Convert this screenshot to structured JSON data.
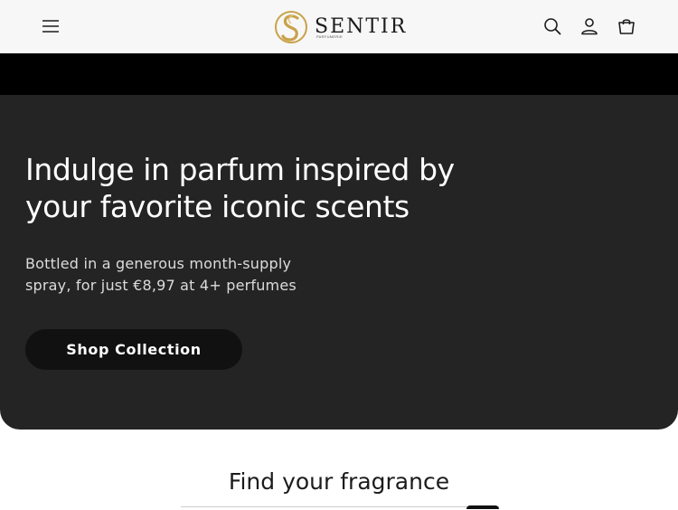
{
  "header": {
    "brand": "SENTIR",
    "brand_sub": "PARFUMERIE",
    "icons": {
      "menu": "hamburger-menu-icon",
      "search": "search-icon",
      "account": "account-icon",
      "cart": "cart-icon"
    }
  },
  "hero": {
    "title": "Indulge in parfum inspired by your favorite iconic scents",
    "subtitle": "Bottled in a generous month-supply spray, for just €8,97 at 4+ perfumes",
    "cta_label": "Shop Collection"
  },
  "fragrance_section": {
    "title": "Find your fragrance"
  },
  "colors": {
    "header_bg": "#f7f7f7",
    "hero_bg": "#242424",
    "band": "#000000",
    "button_bg": "#111111",
    "logo_gold": "#c9a24a"
  }
}
